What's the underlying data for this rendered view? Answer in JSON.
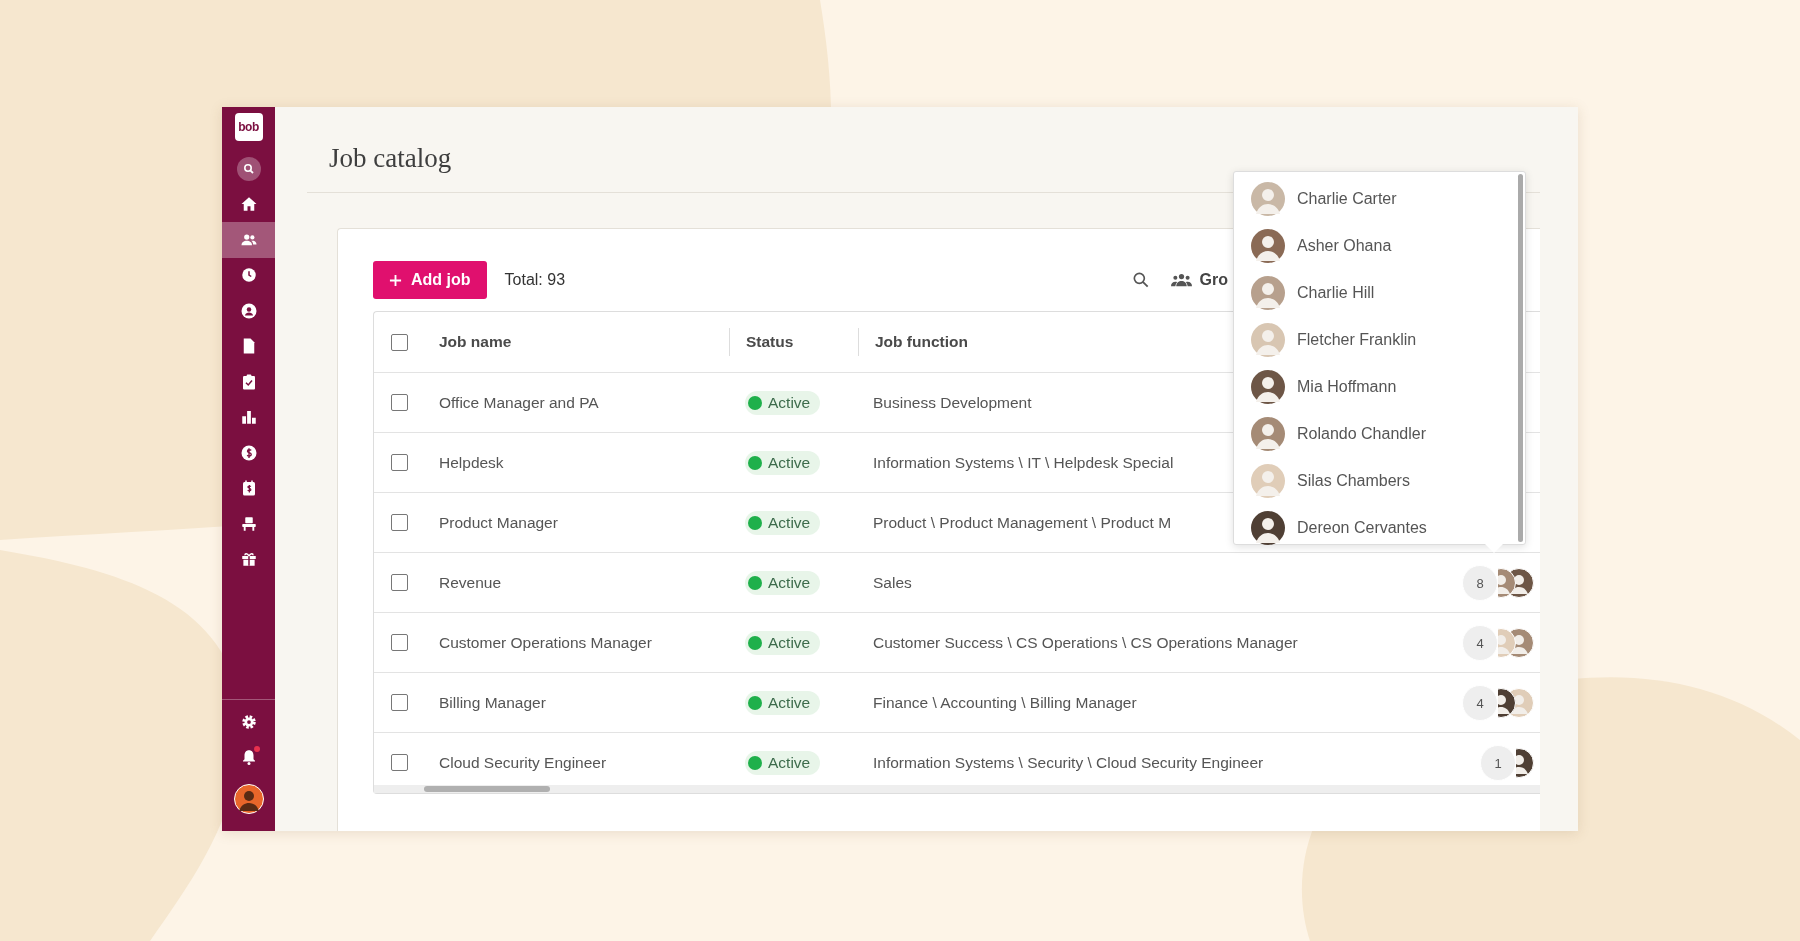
{
  "sidebar": {
    "logo": "bob",
    "items": [
      {
        "kind": "search",
        "selected": false
      },
      {
        "kind": "home",
        "selected": false
      },
      {
        "kind": "people",
        "selected": true
      },
      {
        "kind": "clock",
        "selected": false
      },
      {
        "kind": "profile",
        "selected": false
      },
      {
        "kind": "document",
        "selected": false
      },
      {
        "kind": "tasks",
        "selected": false
      },
      {
        "kind": "analytics",
        "selected": false
      },
      {
        "kind": "payroll",
        "selected": false
      },
      {
        "kind": "payslip",
        "selected": false
      },
      {
        "kind": "workspace",
        "selected": false
      },
      {
        "kind": "perks",
        "selected": false
      }
    ],
    "bottom_items": [
      {
        "kind": "settings"
      },
      {
        "kind": "notifications",
        "unread": true
      },
      {
        "kind": "avatar"
      }
    ]
  },
  "page": {
    "title": "Job catalog"
  },
  "toolbar": {
    "add_button": "Add job",
    "total": "Total: 93",
    "group_button": "Gro"
  },
  "table": {
    "header_checked": false,
    "columns": [
      "Job name",
      "Status",
      "Job function"
    ],
    "rows": [
      {
        "checked": false,
        "job_name": "Office Manager and PA",
        "status": "Active",
        "job_function": "Business Development"
      },
      {
        "checked": false,
        "job_name": "Helpdesk",
        "status": "Active",
        "job_function": "Information Systems \\ IT \\ Helpdesk Special"
      },
      {
        "checked": false,
        "job_name": "Product Manager",
        "status": "Active",
        "job_function": "Product \\ Product Management \\ Product M"
      },
      {
        "checked": false,
        "job_name": "Revenue",
        "status": "Active",
        "job_function": "Sales",
        "count": "8"
      },
      {
        "checked": false,
        "job_name": "Customer Operations Manager",
        "status": "Active",
        "job_function": "Customer Success \\ CS Operations \\ CS Operations Manager",
        "count": "4"
      },
      {
        "checked": false,
        "job_name": "Billing Manager",
        "status": "Active",
        "job_function": "Finance \\ Accounting \\ Billing Manager",
        "count": "4"
      },
      {
        "checked": false,
        "job_name": "Cloud Security Engineer",
        "status": "Active",
        "job_function": "Information Systems \\ Security \\ Cloud Security Engineer",
        "count": "1"
      }
    ]
  },
  "people_popup": {
    "people": [
      {
        "name": "Charlie Carter"
      },
      {
        "name": "Asher Ohana"
      },
      {
        "name": "Charlie Hill"
      },
      {
        "name": "Fletcher Franklin"
      },
      {
        "name": "Mia Hoffmann"
      },
      {
        "name": "Rolando Chandler"
      },
      {
        "name": "Silas Chambers"
      },
      {
        "name": "Dereon Cervantes"
      }
    ]
  }
}
